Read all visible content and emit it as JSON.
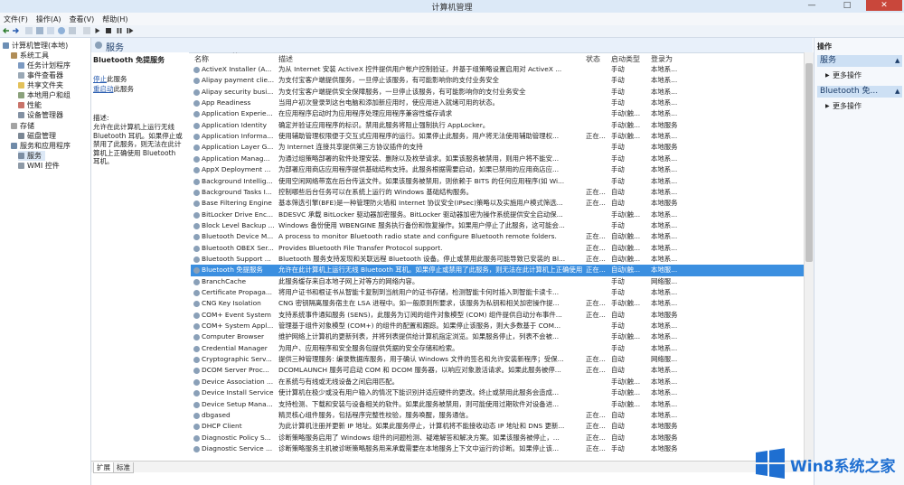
{
  "window": {
    "title": "计算机管理",
    "minimize": "—",
    "maximize": "□",
    "close": "✕"
  },
  "menu": [
    "文件(F)",
    "操作(A)",
    "查看(V)",
    "帮助(H)"
  ],
  "tree": [
    {
      "label": "计算机管理(本地)",
      "icon": "computer-icon"
    },
    {
      "label": "系统工具",
      "icon": "tools-icon"
    },
    {
      "label": "任务计划程序",
      "icon": "clock-icon"
    },
    {
      "label": "事件查看器",
      "icon": "event-icon"
    },
    {
      "label": "共享文件夹",
      "icon": "folder-icon"
    },
    {
      "label": "本地用户和组",
      "icon": "users-icon"
    },
    {
      "label": "性能",
      "icon": "performance-icon"
    },
    {
      "label": "设备管理器",
      "icon": "device-icon"
    },
    {
      "label": "存储",
      "icon": "storage-icon"
    },
    {
      "label": "磁盘管理",
      "icon": "disk-icon"
    },
    {
      "label": "服务和应用程序",
      "icon": "apps-icon"
    },
    {
      "label": "服务",
      "icon": "services-icon"
    },
    {
      "label": "WMI 控件",
      "icon": "wmi-icon"
    }
  ],
  "services_header": "服务",
  "desc": {
    "title": "Bluetooth 免提服务",
    "stop_link": "停止",
    "stop_suffix": "此服务",
    "restart_link": "重启动",
    "restart_suffix": "此服务",
    "label": "描述:",
    "text": "允许在此计算机上运行无线 Bluetooth 耳机。如果停止或禁用了此服务，则无法在此计算机上正确使用 Bluetooth 耳机。"
  },
  "columns": {
    "name": "名称",
    "description": "描述",
    "status": "状态",
    "startup": "启动类型",
    "logon": "登录为"
  },
  "rows": [
    {
      "name": "ActiveX Installer (A...",
      "desc": "为从 Internet 安装 ActiveX 控件提供用户帐户控制验证，并基于组策略设置启用对 ActiveX ...",
      "status": "",
      "startup": "手动",
      "logon": "本地系..."
    },
    {
      "name": "Alipay payment clie...",
      "desc": "为支付宝客户端提供服务，一旦停止该服务，有可能影响你的支付业务安全",
      "status": "",
      "startup": "手动",
      "logon": "本地系..."
    },
    {
      "name": "Alipay security busi...",
      "desc": "为支付宝客户端提供安全保障服务，一旦停止该服务，有可能影响你的支付业务安全",
      "status": "",
      "startup": "手动",
      "logon": "本地系..."
    },
    {
      "name": "App Readiness",
      "desc": "当用户初次登录到这台电脑和添加新应用时，使应用进入就绪可用的状态。",
      "status": "",
      "startup": "手动",
      "logon": "本地系..."
    },
    {
      "name": "Application Experie...",
      "desc": "在应用程序启动时为应用程序处理应用程序兼容性缓存请求",
      "status": "",
      "startup": "手动(触...",
      "logon": "本地系..."
    },
    {
      "name": "Application Identity",
      "desc": "确定并验证应用程序的标识。禁用此服务将阻止强制执行 AppLocker。",
      "status": "",
      "startup": "手动(触...",
      "logon": "本地服务"
    },
    {
      "name": "Application Informa...",
      "desc": "使用辅助管理权限便于交互式应用程序的运行。如果停止此服务，用户将无法使用辅助管理权...",
      "status": "正在...",
      "startup": "手动(触...",
      "logon": "本地系..."
    },
    {
      "name": "Application Layer G...",
      "desc": "为 Internet 连接共享提供第三方协议插件的支持",
      "status": "",
      "startup": "手动",
      "logon": "本地服务"
    },
    {
      "name": "Application Manag...",
      "desc": "为通过组策略部署的软件处理安装、删除以及枚举请求。如果该服务被禁用，则用户将不能安...",
      "status": "",
      "startup": "手动",
      "logon": "本地系..."
    },
    {
      "name": "AppX Deployment ...",
      "desc": "为部署应用商店应用程序提供基础结构支持。此服务根据需要启动，如果已禁用的应用商店应...",
      "status": "",
      "startup": "手动",
      "logon": "本地系..."
    },
    {
      "name": "Background Intellig...",
      "desc": "使用空闲网络带宽在后台传送文件。如果该服务被禁用，则依赖于 BITS 的任何应用程序(如 Wi...",
      "status": "",
      "startup": "手动",
      "logon": "本地系..."
    },
    {
      "name": "Background Tasks I...",
      "desc": "控制哪些后台任务可以在系统上运行的 Windows 基础结构服务。",
      "status": "正在...",
      "startup": "自动",
      "logon": "本地系..."
    },
    {
      "name": "Base Filtering Engine",
      "desc": "基本筛选引擎(BFE)是一种管理防火墙和 Internet 协议安全(IPsec)策略以及实施用户模式筛选...",
      "status": "正在...",
      "startup": "自动",
      "logon": "本地服务"
    },
    {
      "name": "BitLocker Drive Enc...",
      "desc": "BDESVC 承载 BitLocker 驱动器加密服务。BitLocker 驱动器加密为操作系统提供安全启动保...",
      "status": "",
      "startup": "手动(触...",
      "logon": "本地系..."
    },
    {
      "name": "Block Level Backup ...",
      "desc": "Windows 备份使用 WBENGINE 服务执行备份和恢复操作。如果用户停止了此服务，这可能会...",
      "status": "",
      "startup": "手动",
      "logon": "本地系..."
    },
    {
      "name": "Bluetooth Device M...",
      "desc": "A process to monitor Bluetooth radio state and configure Bluetooth remote folders.",
      "status": "正在...",
      "startup": "自动(触...",
      "logon": "本地系..."
    },
    {
      "name": "Bluetooth OBEX Ser...",
      "desc": "Provides Bluetooth File Transfer Protocol support.",
      "status": "正在...",
      "startup": "自动(触...",
      "logon": "本地系..."
    },
    {
      "name": "Bluetooth Support ...",
      "desc": "Bluetooth 服务支持发现和关联远程 Bluetooth 设备。停止或禁用此服务可能导致已安装的 Bl...",
      "status": "正在...",
      "startup": "自动(触...",
      "logon": "本地系..."
    },
    {
      "name": "Bluetooth 免提服务",
      "desc": "允许在此计算机上运行无线 Bluetooth 耳机。如果停止或禁用了此服务，则无法在此计算机上正确使用 Bl...",
      "status": "正在...",
      "startup": "自动(触...",
      "logon": "本地服..."
    },
    {
      "name": "BranchCache",
      "desc": "此服务缓存来自本地子网上对等方的网络内容。",
      "status": "",
      "startup": "手动",
      "logon": "网络服..."
    },
    {
      "name": "Certificate Propaga...",
      "desc": "将用户证书和根证书从智能卡复制到当前用户的证书存储，检测智能卡何时插入到智能卡读卡...",
      "status": "",
      "startup": "手动",
      "logon": "本地系..."
    },
    {
      "name": "CNG Key Isolation",
      "desc": "CNG 密钥隔离服务宿主在 LSA 进程中。如一般原则所要求，该服务为私钥和相关加密操作提...",
      "status": "正在...",
      "startup": "手动(触...",
      "logon": "本地系..."
    },
    {
      "name": "COM+ Event System",
      "desc": "支持系统事件通知服务 (SENS)，此服务为订阅的组件对象模型 (COM) 组件提供自动分布事件...",
      "status": "正在...",
      "startup": "自动",
      "logon": "本地服务"
    },
    {
      "name": "COM+ System Appl...",
      "desc": "管理基于组件对象模型 (COM+) 的组件的配置和跟踪。如果停止该服务，则大多数基于 COM...",
      "status": "",
      "startup": "手动",
      "logon": "本地系..."
    },
    {
      "name": "Computer Browser",
      "desc": "维护网络上计算机的更新列表，并将列表提供给计算机指定浏览。如果服务停止，列表不会被...",
      "status": "",
      "startup": "手动(触...",
      "logon": "本地系..."
    },
    {
      "name": "Credential Manager",
      "desc": "为用户、应用程序和安全服务包提供凭据的安全存储和检索。",
      "status": "",
      "startup": "手动",
      "logon": "本地系..."
    },
    {
      "name": "Cryptographic Serv...",
      "desc": "提供三种管理服务: 编录数据库服务，用于确认 Windows 文件的签名和允许安装新程序；受保...",
      "status": "正在...",
      "startup": "自动",
      "logon": "网络服..."
    },
    {
      "name": "DCOM Server Proc...",
      "desc": "DCOMLAUNCH 服务可启动 COM 和 DCOM 服务器，以响应对象激活请求。如果此服务被停...",
      "status": "正在...",
      "startup": "自动",
      "logon": "本地系..."
    },
    {
      "name": "Device Association ...",
      "desc": "在系统与有线或无线设备之间启用匹配。",
      "status": "",
      "startup": "手动(触...",
      "logon": "本地系..."
    },
    {
      "name": "Device Install Service",
      "desc": "使计算机在极少或没有用户输入的情况下能识别并适应硬件的更改。终止或禁用此服务会造成...",
      "status": "",
      "startup": "手动(触...",
      "logon": "本地系..."
    },
    {
      "name": "Device Setup Mana...",
      "desc": "支持检测、下载和安装与设备相关的软件。如果此服务被禁用，则可能使用过期软件对设备进...",
      "status": "",
      "startup": "手动(触...",
      "logon": "本地系..."
    },
    {
      "name": "dbgased",
      "desc": "精灵核心组件服务，包括程序完整性校验，服务唤醒，服务通信。",
      "status": "正在...",
      "startup": "自动",
      "logon": "本地系..."
    },
    {
      "name": "DHCP Client",
      "desc": "为此计算机注册并更新 IP 地址。如果此服务停止，计算机将不能接收动态 IP 地址和 DNS 更新...",
      "status": "正在...",
      "startup": "自动",
      "logon": "本地服务"
    },
    {
      "name": "Diagnostic Policy S...",
      "desc": "诊断策略服务启用了 Windows 组件的问题检测、疑难解答和解决方案。如果该服务被停止，...",
      "status": "正在...",
      "startup": "自动",
      "logon": "本地服务"
    },
    {
      "name": "Diagnostic Service ...",
      "desc": "诊断策略服务主机被诊断策略服务用来承载需要在本地服务上下文中运行的诊断。如果停止该...",
      "status": "正在...",
      "startup": "手动",
      "logon": "本地服务"
    }
  ],
  "selected_index": 18,
  "tabs": [
    "扩展",
    "标准"
  ],
  "actions": {
    "title": "操作",
    "groups": [
      {
        "head": "服务",
        "item": "更多操作"
      },
      {
        "head": "Bluetooth 免...",
        "item": "更多操作"
      }
    ]
  },
  "watermark": {
    "text": "Win8系统之家"
  },
  "colors": {
    "selection": "#3b8fe0",
    "accent": "#1f6fd1",
    "close": "#c9473b"
  }
}
